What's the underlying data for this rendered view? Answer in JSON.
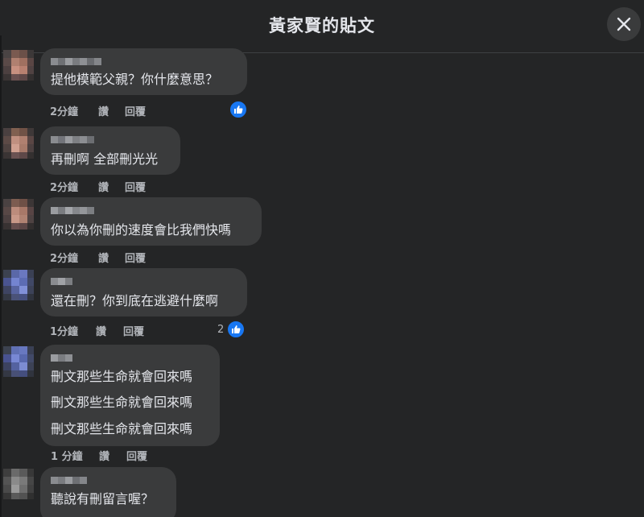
{
  "header": {
    "title": "黃家賢的貼文"
  },
  "comments": [
    {
      "text": "提他模範父親？你什麼意思？",
      "time": "2分鐘",
      "like": "讚",
      "reply": "回覆",
      "reactions": ""
    },
    {
      "text": "再刪啊 全部刪光光",
      "time": "2分鐘",
      "like": "讚",
      "reply": "回覆"
    },
    {
      "text": "你以為你刪的速度會比我們快嗎",
      "time": "2分鐘",
      "like": "讚",
      "reply": "回覆"
    },
    {
      "text": "還在刪？你到底在逃避什麼啊",
      "time": "1分鐘",
      "like": "讚",
      "reply": "回覆",
      "reactions": "2"
    },
    {
      "lines": [
        "刪文那些生命就會回來嗎",
        "刪文那些生命就會回來嗎",
        "刪文那些生命就會回來嗎"
      ],
      "time": "1 分鐘",
      "like": "讚",
      "reply": "回覆"
    },
    {
      "text": "聽說有刪留言喔？"
    }
  ],
  "icons": {
    "close": "close-icon",
    "like": "like-reaction-icon"
  },
  "colors": {
    "background": "#242526",
    "bubble": "#3a3b3c",
    "like_blue": "#1877f2",
    "meta_text": "#b0b3b8"
  }
}
